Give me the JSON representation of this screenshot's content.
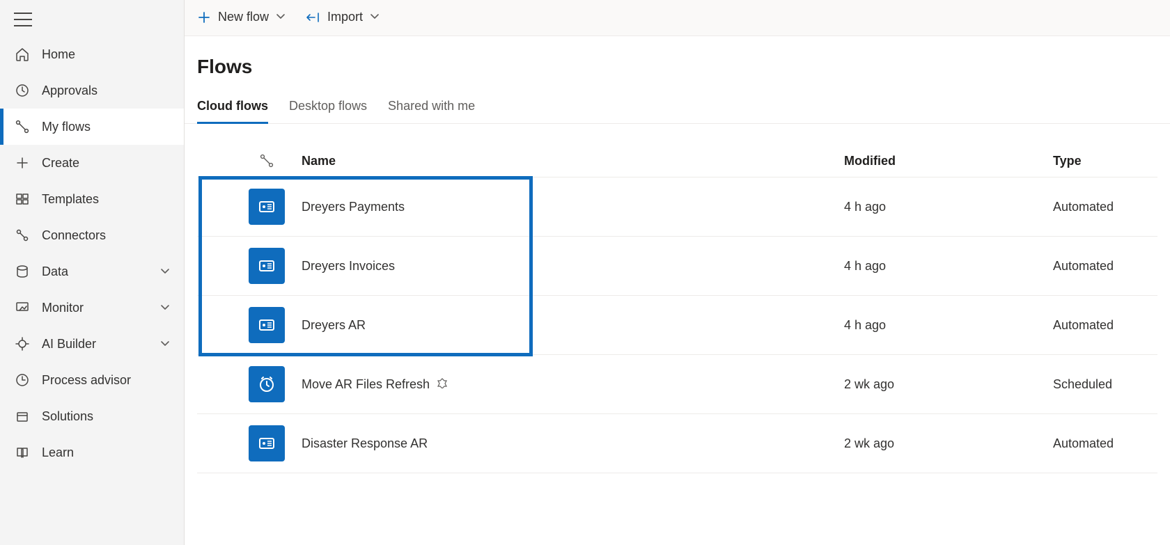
{
  "sidebar": {
    "items": [
      {
        "id": "home",
        "label": "Home",
        "icon": "home-icon",
        "expandable": false
      },
      {
        "id": "approvals",
        "label": "Approvals",
        "icon": "approvals-icon",
        "expandable": false
      },
      {
        "id": "myflows",
        "label": "My flows",
        "icon": "flows-icon",
        "expandable": false,
        "active": true
      },
      {
        "id": "create",
        "label": "Create",
        "icon": "plus-icon",
        "expandable": false
      },
      {
        "id": "templates",
        "label": "Templates",
        "icon": "templates-icon",
        "expandable": false
      },
      {
        "id": "connectors",
        "label": "Connectors",
        "icon": "connectors-icon",
        "expandable": false
      },
      {
        "id": "data",
        "label": "Data",
        "icon": "data-icon",
        "expandable": true
      },
      {
        "id": "monitor",
        "label": "Monitor",
        "icon": "monitor-icon",
        "expandable": true
      },
      {
        "id": "aibuilder",
        "label": "AI Builder",
        "icon": "aibuilder-icon",
        "expandable": true
      },
      {
        "id": "processadvisor",
        "label": "Process advisor",
        "icon": "processadvisor-icon",
        "expandable": false
      },
      {
        "id": "solutions",
        "label": "Solutions",
        "icon": "solutions-icon",
        "expandable": false
      },
      {
        "id": "learn",
        "label": "Learn",
        "icon": "learn-icon",
        "expandable": false
      }
    ]
  },
  "commandbar": {
    "newflow": "New flow",
    "import": "Import"
  },
  "page": {
    "title": "Flows"
  },
  "tabs": [
    {
      "id": "cloud",
      "label": "Cloud flows",
      "active": true
    },
    {
      "id": "desktop",
      "label": "Desktop flows",
      "active": false
    },
    {
      "id": "shared",
      "label": "Shared with me",
      "active": false
    }
  ],
  "columns": {
    "name": "Name",
    "modified": "Modified",
    "type": "Type"
  },
  "rows": [
    {
      "name": "Dreyers Payments",
      "modified": "4 h ago",
      "type": "Automated",
      "icon": "automated",
      "premium": false
    },
    {
      "name": "Dreyers Invoices",
      "modified": "4 h ago",
      "type": "Automated",
      "icon": "automated",
      "premium": false
    },
    {
      "name": "Dreyers AR",
      "modified": "4 h ago",
      "type": "Automated",
      "icon": "automated",
      "premium": false
    },
    {
      "name": "Move AR Files Refresh",
      "modified": "2 wk ago",
      "type": "Scheduled",
      "icon": "scheduled",
      "premium": true
    },
    {
      "name": "Disaster Response AR",
      "modified": "2 wk ago",
      "type": "Automated",
      "icon": "automated",
      "premium": false
    }
  ],
  "highlight": {
    "row_start": 0,
    "row_end": 2
  }
}
